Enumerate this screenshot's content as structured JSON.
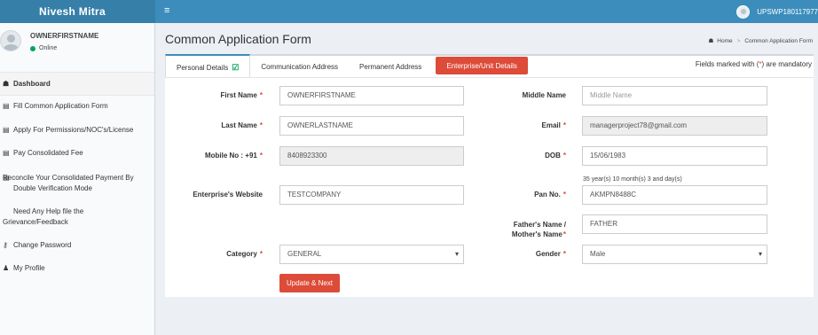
{
  "topbar": {
    "brand": "Nivesh Mitra",
    "menu_toggle": "≡",
    "user_id": "UPSWP180117977"
  },
  "sidebar": {
    "user_name": "OWNERFIRSTNAME",
    "status": "Online",
    "items": [
      {
        "icon": "dashboard-icon",
        "glyph": "☗",
        "label": "Dashboard"
      },
      {
        "icon": "form-icon",
        "glyph": "▤",
        "label": "Fill Common Application Form"
      },
      {
        "icon": "form-icon",
        "glyph": "▤",
        "label": "Apply For Permissions/NOC's/License"
      },
      {
        "icon": "form-icon",
        "glyph": "▤",
        "label": "Pay Consolidated Fee"
      },
      {
        "icon": "form-icon",
        "glyph": "▤",
        "label": "Reconcile Your Consolidated Payment By Double Verification Mode"
      },
      {
        "icon": "",
        "glyph": "",
        "label": "Need Any Help file the Grievance/Feedback"
      },
      {
        "icon": "key-icon",
        "glyph": "⚷",
        "label": "Change Password"
      },
      {
        "icon": "user-icon",
        "glyph": "♟",
        "label": "My Profile"
      }
    ]
  },
  "page": {
    "title": "Common Application Form",
    "breadcrumb": {
      "home": "Home",
      "separator": ">",
      "current": "Common Application Form"
    }
  },
  "tabs": [
    {
      "label": "Personal Details"
    },
    {
      "label": "Communication Address"
    },
    {
      "label": "Permanent Address"
    },
    {
      "label": "Enterprise/Unit Details"
    }
  ],
  "mandatory_note": {
    "before": "Fields marked with (",
    "star": "*",
    "after": ") are mandatory"
  },
  "form": {
    "first_name": {
      "label": "First Name",
      "value": "OWNERFIRSTNAME"
    },
    "middle_name": {
      "label": "Middle Name",
      "placeholder": "Middle Name"
    },
    "last_name": {
      "label": "Last Name",
      "value": "OWNERLASTNAME"
    },
    "email": {
      "label": "Email",
      "value": "managerproject78@gmail.com"
    },
    "mobile": {
      "label": "Mobile No : +91",
      "value": "8408923300"
    },
    "dob": {
      "label": "DOB",
      "value": "15/06/1983",
      "age_text": "35 year(s) 10 month(s) 3 and day(s)"
    },
    "website": {
      "label": "Enterprise's Website",
      "value": "TESTCOMPANY"
    },
    "pan": {
      "label": "Pan No.",
      "value": "AKMPN8488C"
    },
    "father_name": {
      "label_line1": "Father's Name /",
      "label_line2": "Mother's Name",
      "value": "FATHER"
    },
    "category": {
      "label": "Category",
      "value": "GENERAL"
    },
    "gender": {
      "label": "Gender",
      "value": "Male"
    },
    "required_star": "*",
    "submit_label": "Update & Next"
  },
  "colors": {
    "primary": "#3c8dbc",
    "danger": "#dd4b39",
    "success": "#00a65a"
  }
}
